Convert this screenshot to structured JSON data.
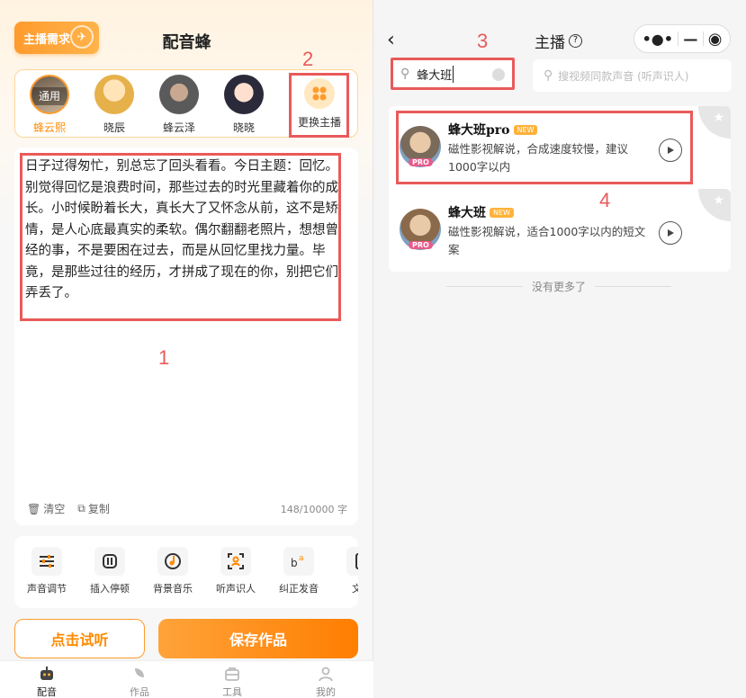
{
  "left": {
    "badge": "主播需求",
    "app_title": "配音蜂",
    "voices": [
      {
        "name": "蜂云熙",
        "tag": "通用",
        "active": true
      },
      {
        "name": "晓辰"
      },
      {
        "name": "蜂云泽"
      },
      {
        "name": "晓晓"
      }
    ],
    "change_host": "更换主播",
    "editor_text": "日子过得匆忙，别总忘了回头看看。今日主题：回忆。\n别觉得回忆是浪费时间，那些过去的时光里藏着你的成长。小时候盼着长大，真长大了又怀念从前，这不是矫情，是人心底最真实的柔软。偶尔翻翻老照片，想想曾经的事，不是要困在过去，而是从回忆里找力量。毕竟，是那些过往的经历，才拼成了现在的你，别把它们弄丢了。",
    "clear": "清空",
    "copy": "复制",
    "char_count": "148/10000 字",
    "tools": [
      "声音调节",
      "插入停顿",
      "背景音乐",
      "听声识人",
      "纠正发音",
      "文案"
    ],
    "preview_button": "点击试听",
    "save_button": "保存作品",
    "tabs": [
      "配音",
      "作品",
      "工具",
      "我的"
    ]
  },
  "right": {
    "title": "主播",
    "search_value": "蜂大班",
    "search_video_placeholder": "搜视频同款声音 (听声识人)",
    "results": [
      {
        "name": "蜂大班pro",
        "badge": "NEW",
        "pro": "PRO",
        "desc": "磁性影视解说，合成速度较慢，建议1000字以内"
      },
      {
        "name": "蜂大班",
        "badge": "NEW",
        "pro": "PRO",
        "desc": "磁性影视解说，适合1000字以内的短文案"
      }
    ],
    "no_more": "没有更多了"
  },
  "annotations": [
    "1",
    "2",
    "3",
    "4"
  ],
  "colors": {
    "accent": "#ff8a00",
    "annotation": "#e95a5a"
  }
}
